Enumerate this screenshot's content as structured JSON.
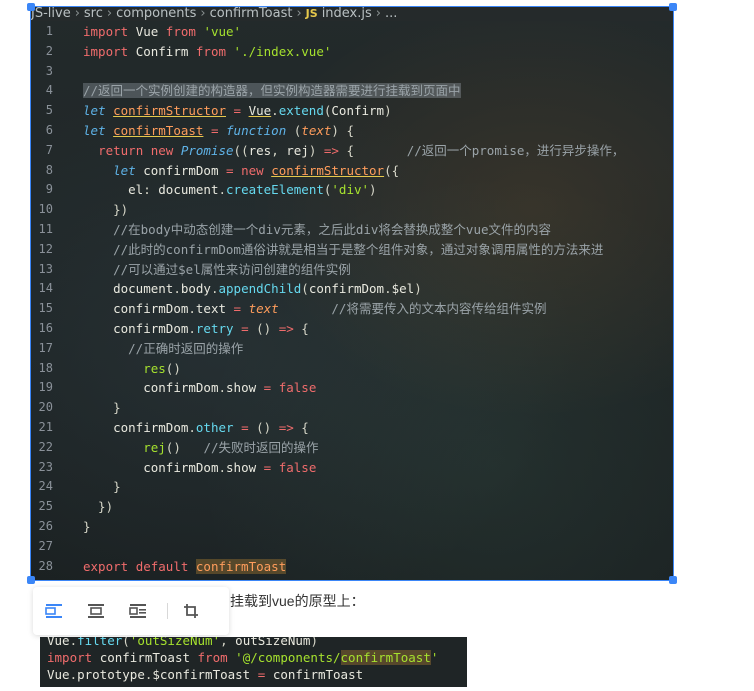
{
  "breadcrumb": {
    "items": [
      "JS-live",
      "src",
      "components",
      "confirmToast"
    ],
    "file_badge": "JS",
    "file_name": "index.js",
    "ellipsis": "..."
  },
  "code_lines": [
    {
      "n": "1",
      "html": "<span class=\"kw\">import</span> <span class=\"var\">Vue</span> <span class=\"kw\">from</span> <span class=\"str\">'vue'</span>"
    },
    {
      "n": "2",
      "html": "<span class=\"kw\">import</span> <span class=\"var\">Confirm</span> <span class=\"kw\">from</span> <span class=\"str\">'./index.vue'</span>"
    },
    {
      "n": "3",
      "html": ""
    },
    {
      "n": "4",
      "html": "<span class=\"cm sel\">//返回一个实例创建的构造器，但实例构造器需要进行挂载到页面中</span>"
    },
    {
      "n": "5",
      "html": "<span class=\"kwi\">let</span> <span class=\"orange ul\">confirmStructor</span> <span class=\"kw\">=</span> <span class=\"var ul\">Vue</span>.<span class=\"fn\">extend</span>(<span class=\"var\">Confirm</span>)"
    },
    {
      "n": "6",
      "html": "<span class=\"kwi\">let</span> <span class=\"orange ul\">confirmToast</span> <span class=\"kw\">=</span> <span class=\"kwi\">function</span> (<span class=\"orange\" style=\"font-style:italic\">text</span>) {"
    },
    {
      "n": "7",
      "html": "  <span class=\"kw\">return</span> <span class=\"kw\">new</span> <span class=\"kwi\">Promise</span>((<span class=\"var\">res</span>, <span class=\"var\">rej</span>) <span class=\"kw\">=&gt;</span> {       <span class=\"cm\">//返回一个promise，进行异步操作，</span>"
    },
    {
      "n": "8",
      "html": "    <span class=\"kwi\">let</span> <span class=\"var\">confirmDom</span> <span class=\"kw\">=</span> <span class=\"kw\">new</span> <span class=\"orange ul\">confirmStructor</span>({"
    },
    {
      "n": "9",
      "html": "      <span class=\"var\">el</span>: <span class=\"var\">document</span>.<span class=\"fn\">createElement</span>(<span class=\"str\">'div'</span>)"
    },
    {
      "n": "10",
      "html": "    })"
    },
    {
      "n": "11",
      "html": "    <span class=\"cm\">//在body中动态创建一个div元素，之后此div将会替换成整个vue文件的内容</span>"
    },
    {
      "n": "12",
      "html": "    <span class=\"cm\">//此时的confirmDom通俗讲就是相当于是整个组件对象，通过对象调用属性的方法来进</span>"
    },
    {
      "n": "13",
      "html": "    <span class=\"cm\">//可以通过$el属性来访问创建的组件实例</span>"
    },
    {
      "n": "14",
      "html": "    <span class=\"var\">document</span>.<span class=\"var\">body</span>.<span class=\"fn\">appendChild</span>(<span class=\"var\">confirmDom</span>.<span class=\"var\">$el</span>)"
    },
    {
      "n": "15",
      "html": "    <span class=\"var\">confirmDom</span>.<span class=\"var\">text</span> <span class=\"kw\">=</span> <span class=\"orange\" style=\"font-style:italic\">text</span>       <span class=\"cm\">//将需要传入的文本内容传给组件实例</span>"
    },
    {
      "n": "16",
      "html": "    <span class=\"var\">confirmDom</span>.<span class=\"fn\">retry</span> <span class=\"kw\">=</span> () <span class=\"kw\">=&gt;</span> {"
    },
    {
      "n": "17",
      "html": "      <span class=\"cm\">//正确时返回的操作</span>"
    },
    {
      "n": "18",
      "html": "        <span class=\"str\">res</span>()"
    },
    {
      "n": "19",
      "html": "        <span class=\"var\">confirmDom</span>.<span class=\"var\">show</span> <span class=\"kw\">=</span> <span class=\"kw\">false</span>"
    },
    {
      "n": "20",
      "html": "    }"
    },
    {
      "n": "21",
      "html": "    <span class=\"var\">confirmDom</span>.<span class=\"fn\">other</span> <span class=\"kw\">=</span> () <span class=\"kw\">=&gt;</span> {"
    },
    {
      "n": "22",
      "html": "        <span class=\"str\">rej</span>()   <span class=\"cm\">//失败时返回的操作</span>"
    },
    {
      "n": "23",
      "html": "        <span class=\"var\">confirmDom</span>.<span class=\"var\">show</span> <span class=\"kw\">=</span> <span class=\"kw\">false</span>"
    },
    {
      "n": "24",
      "html": "    }"
    },
    {
      "n": "25",
      "html": "  })"
    },
    {
      "n": "26",
      "html": "}"
    },
    {
      "n": "27",
      "html": ""
    },
    {
      "n": "28",
      "html": "<span class=\"kw\">export</span> <span class=\"kw\">default</span> <span class=\"orange hl\">confirmToast</span>"
    }
  ],
  "toolbar": {
    "align_left_label": "align-left",
    "align_center_label": "align-center",
    "align_right_label": "align-right",
    "crop_label": "crop"
  },
  "paragraph": {
    "text": "挂载到vue的原型上："
  },
  "snippet_lines": [
    {
      "html": "<span class=\"var\">Vue</span>.<span class=\"fn\">filter</span>(<span class=\"str\">'outSizeNum'</span>, <span class=\"var\">outSizeNum</span>)"
    },
    {
      "html": "<span class=\"kw\">import</span> <span class=\"var\">confirmToast</span> <span class=\"kw\">from</span> <span class=\"str\">'@/components/</span><span class=\"str hl\">confirmToast</span><span class=\"str\">'</span>"
    },
    {
      "html": "<span class=\"var\">Vue</span>.<span class=\"var\">prototype</span>.<span class=\"var\">$confirmToast</span> <span class=\"kw\">=</span> <span class=\"var\">confirmToast</span>"
    }
  ],
  "colors": {
    "selection_blue": "#3b86f7",
    "code_bg": "#1f2526"
  }
}
